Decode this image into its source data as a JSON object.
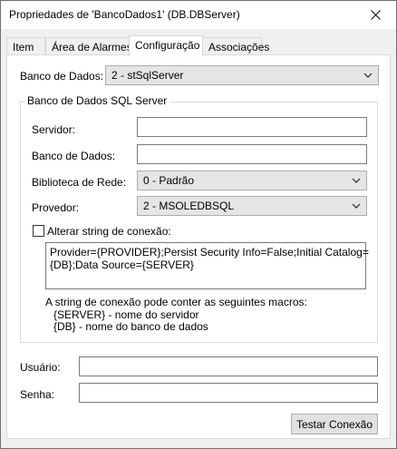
{
  "window": {
    "title": "Propriedades de 'BancoDados1' (DB.DBServer)"
  },
  "tabs": [
    {
      "label": "Item"
    },
    {
      "label": "Área de Alarmes"
    },
    {
      "label": "Configuração"
    },
    {
      "label": "Associações"
    }
  ],
  "config": {
    "db_label": "Banco de Dados:",
    "db_value": "2 - stSqlServer",
    "group_title": "Banco de Dados SQL Server",
    "server_label": "Servidor:",
    "server_value": "",
    "database_label": "Banco de Dados:",
    "database_value": "",
    "netlib_label": "Biblioteca de Rede:",
    "netlib_value": "0 - Padrão",
    "provider_label": "Provedor:",
    "provider_value": "2 - MSOLEDBSQL",
    "alter_label": "Alterar string de conexão:",
    "alter_checked": false,
    "connstring_line1": "Provider={PROVIDER};Persist Security Info=False;Initial Catalog=",
    "connstring_line2": "{DB};Data Source={SERVER}",
    "macros_intro": "A string de conexão pode conter as seguintes macros:",
    "macro_server": "{SERVER} - nome do servidor",
    "macro_db": "{DB} - nome do banco de dados",
    "user_label": "Usuário:",
    "user_value": "",
    "password_label": "Senha:",
    "password_value": "",
    "test_button": "Testar Conexão"
  }
}
